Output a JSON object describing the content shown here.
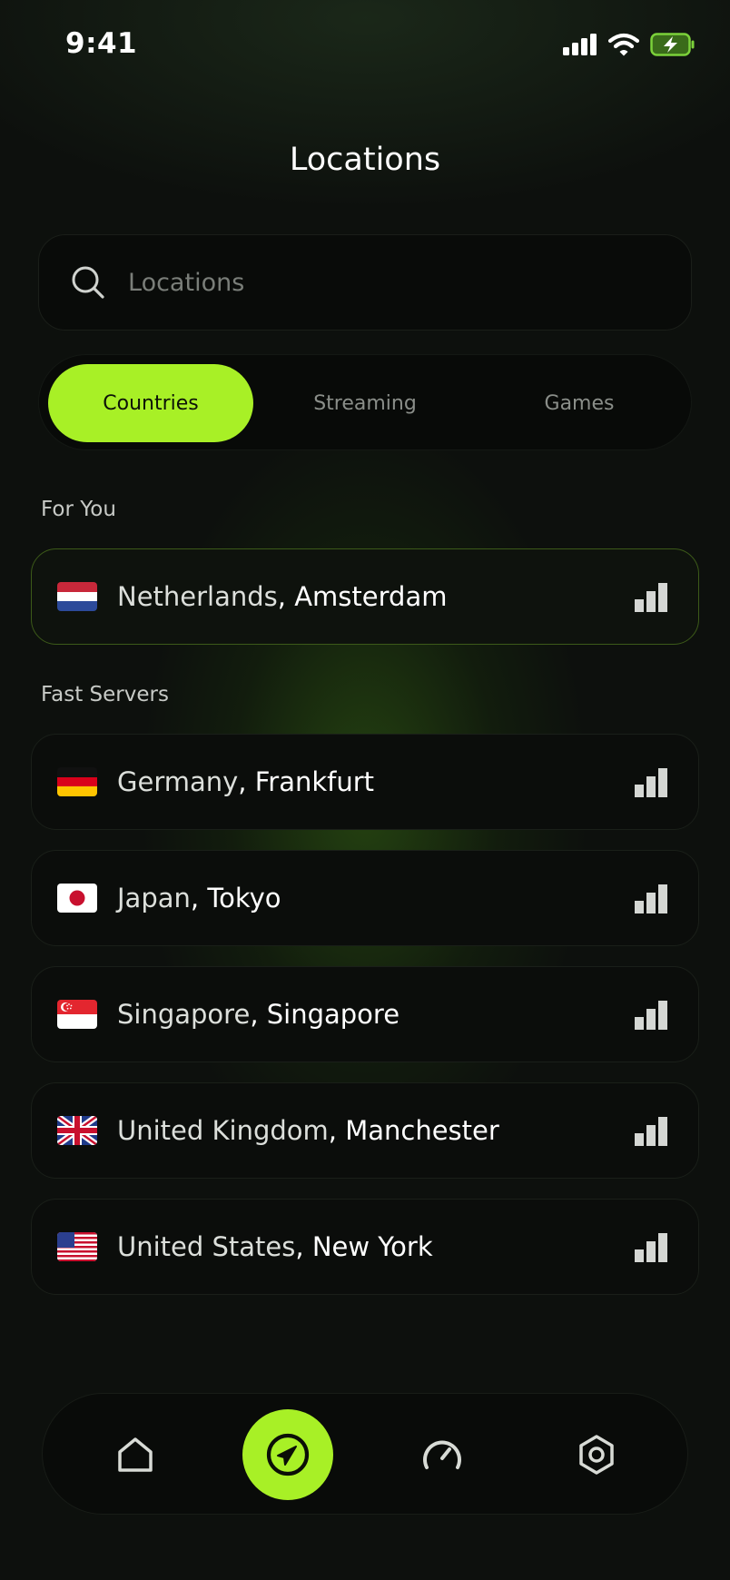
{
  "status_bar": {
    "time": "9:41"
  },
  "header": {
    "title": "Locations"
  },
  "search": {
    "placeholder": "Locations"
  },
  "tabs": [
    {
      "label": "Countries",
      "active": true
    },
    {
      "label": "Streaming",
      "active": false
    },
    {
      "label": "Games",
      "active": false
    }
  ],
  "sections": {
    "for_you": {
      "label": "For You",
      "items": [
        {
          "country": "Netherlands",
          "city": "Amsterdam",
          "flag": "netherlands-flag"
        }
      ]
    },
    "fast_servers": {
      "label": "Fast Servers",
      "items": [
        {
          "country": "Germany",
          "city": "Frankfurt",
          "flag": "germany-flag"
        },
        {
          "country": "Japan",
          "city": "Tokyo",
          "flag": "japan-flag"
        },
        {
          "country": "Singapore",
          "city": "Singapore",
          "flag": "singapore-flag"
        },
        {
          "country": "United Kingdom",
          "city": "Manchester",
          "flag": "uk-flag"
        },
        {
          "country": "United States",
          "city": "New York",
          "flag": "us-flag"
        }
      ]
    }
  },
  "bottom_nav": [
    {
      "icon": "home-icon",
      "active": false
    },
    {
      "icon": "navigation-icon",
      "active": true
    },
    {
      "icon": "speedometer-icon",
      "active": false
    },
    {
      "icon": "settings-icon",
      "active": false
    }
  ],
  "colors": {
    "accent": "#a8f026",
    "background": "#0d100d"
  }
}
